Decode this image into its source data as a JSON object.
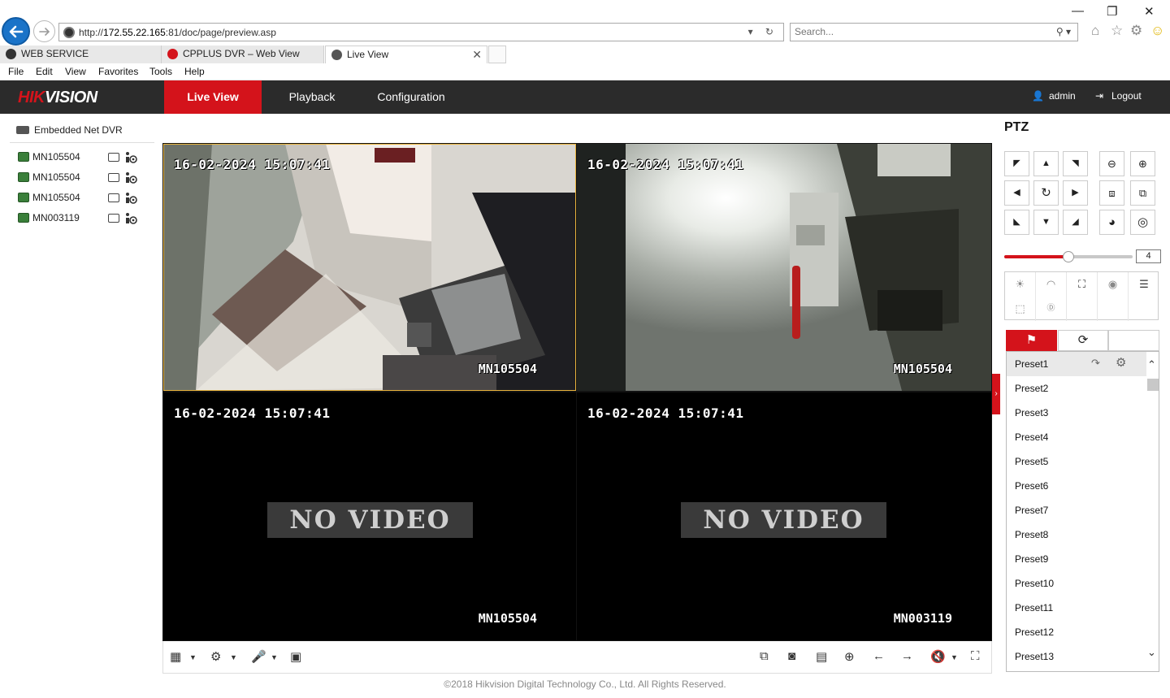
{
  "browser": {
    "url_prefix": "http://",
    "url_host": "172.55.22.165",
    "url_rest": ":81/doc/page/preview.asp",
    "search_placeholder": "Search...",
    "tabs": [
      {
        "label": "WEB SERVICE",
        "icon": "globe-icon",
        "color": "#333333"
      },
      {
        "label": "CPPLUS DVR – Web View",
        "icon": "cpplus-icon",
        "color": "#d4131b"
      },
      {
        "label": "Live View",
        "icon": "ie-page-icon",
        "color": "#444444"
      }
    ],
    "menu": [
      "File",
      "Edit",
      "View",
      "Favorites",
      "Tools",
      "Help"
    ]
  },
  "header": {
    "logo_a": "HIK",
    "logo_b": "VISION",
    "nav": [
      "Live View",
      "Playback",
      "Configuration"
    ],
    "user": "admin",
    "logout": "Logout",
    "accent": "#d4131b"
  },
  "tree": {
    "root": "Embedded Net DVR",
    "cameras": [
      "MN105504",
      "MN105504",
      "MN105504",
      "MN003119"
    ]
  },
  "video": {
    "cells": [
      {
        "timestamp": "16-02-2024  15:07:41",
        "name": "MN105504",
        "has_video": true,
        "selected": true
      },
      {
        "timestamp": "16-02-2024  15:07:41",
        "name": "MN105504",
        "has_video": true,
        "selected": false
      },
      {
        "timestamp": "16-02-2024  15:07:41",
        "name": "MN105504",
        "has_video": false,
        "selected": false
      },
      {
        "timestamp": "16-02-2024  15:07:41",
        "name": "MN003119",
        "has_video": false,
        "selected": false
      }
    ],
    "no_video_text": "NO VIDEO"
  },
  "ptz": {
    "title": "PTZ",
    "speed": "4",
    "speed_fraction": 0.5,
    "presets": [
      "Preset1",
      "Preset2",
      "Preset3",
      "Preset4",
      "Preset5",
      "Preset6",
      "Preset7",
      "Preset8",
      "Preset9",
      "Preset10",
      "Preset11",
      "Preset12",
      "Preset13"
    ]
  },
  "footer": "©2018 Hikvision Digital Technology Co., Ltd. All Rights Reserved."
}
